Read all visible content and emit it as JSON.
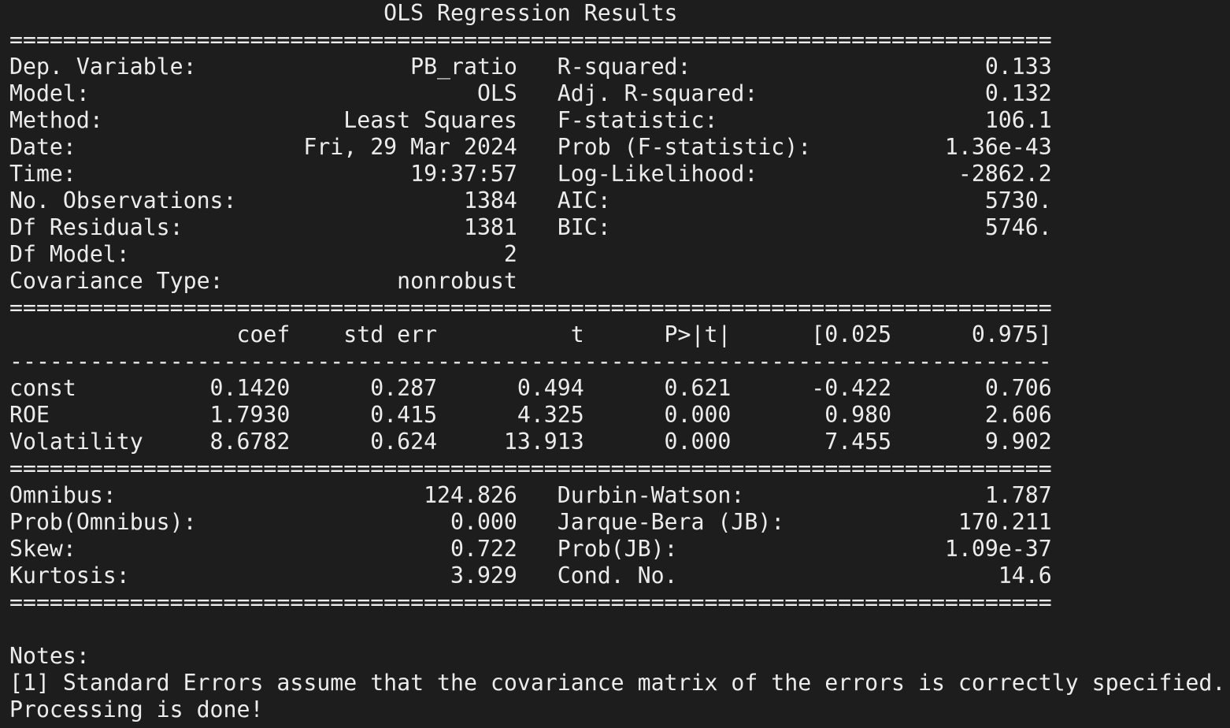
{
  "title": "OLS Regression Results",
  "rule_double": "==============================================================================",
  "rule_single": "------------------------------------------------------------------------------",
  "model_info": [
    {
      "label": "Dep. Variable:",
      "value": "PB_ratio",
      "label2": "R-squared:",
      "value2": "0.133"
    },
    {
      "label": "Model:",
      "value": "OLS",
      "label2": "Adj. R-squared:",
      "value2": "0.132"
    },
    {
      "label": "Method:",
      "value": "Least Squares",
      "label2": "F-statistic:",
      "value2": "106.1"
    },
    {
      "label": "Date:",
      "value": "Fri, 29 Mar 2024",
      "label2": "Prob (F-statistic):",
      "value2": "1.36e-43"
    },
    {
      "label": "Time:",
      "value": "19:37:57",
      "label2": "Log-Likelihood:",
      "value2": "-2862.2"
    },
    {
      "label": "No. Observations:",
      "value": "1384",
      "label2": "AIC:",
      "value2": "5730."
    },
    {
      "label": "Df Residuals:",
      "value": "1381",
      "label2": "BIC:",
      "value2": "5746."
    },
    {
      "label": "Df Model:",
      "value": "2",
      "label2": "",
      "value2": ""
    },
    {
      "label": "Covariance Type:",
      "value": "nonrobust",
      "label2": "",
      "value2": ""
    }
  ],
  "coef_headers": [
    "coef",
    "std err",
    "t",
    "P>|t|",
    "[0.025",
    "0.975]"
  ],
  "coef_rows": [
    {
      "name": "const",
      "values": [
        "0.1420",
        "0.287",
        "0.494",
        "0.621",
        "-0.422",
        "0.706"
      ]
    },
    {
      "name": "ROE",
      "values": [
        "1.7930",
        "0.415",
        "4.325",
        "0.000",
        "0.980",
        "2.606"
      ]
    },
    {
      "name": "Volatility",
      "values": [
        "8.6782",
        "0.624",
        "13.913",
        "0.000",
        "7.455",
        "9.902"
      ]
    }
  ],
  "diagnostics": [
    {
      "label": "Omnibus:",
      "value": "124.826",
      "label2": "Durbin-Watson:",
      "value2": "1.787"
    },
    {
      "label": "Prob(Omnibus):",
      "value": "0.000",
      "label2": "Jarque-Bera (JB):",
      "value2": "170.211"
    },
    {
      "label": "Skew:",
      "value": "0.722",
      "label2": "Prob(JB):",
      "value2": "1.09e-37"
    },
    {
      "label": "Kurtosis:",
      "value": "3.929",
      "label2": "Cond. No.",
      "value2": "14.6"
    }
  ],
  "notes_heading": "Notes:",
  "notes": [
    "[1] Standard Errors assume that the covariance matrix of the errors is correctly specified."
  ],
  "status_message": "Processing is done!"
}
